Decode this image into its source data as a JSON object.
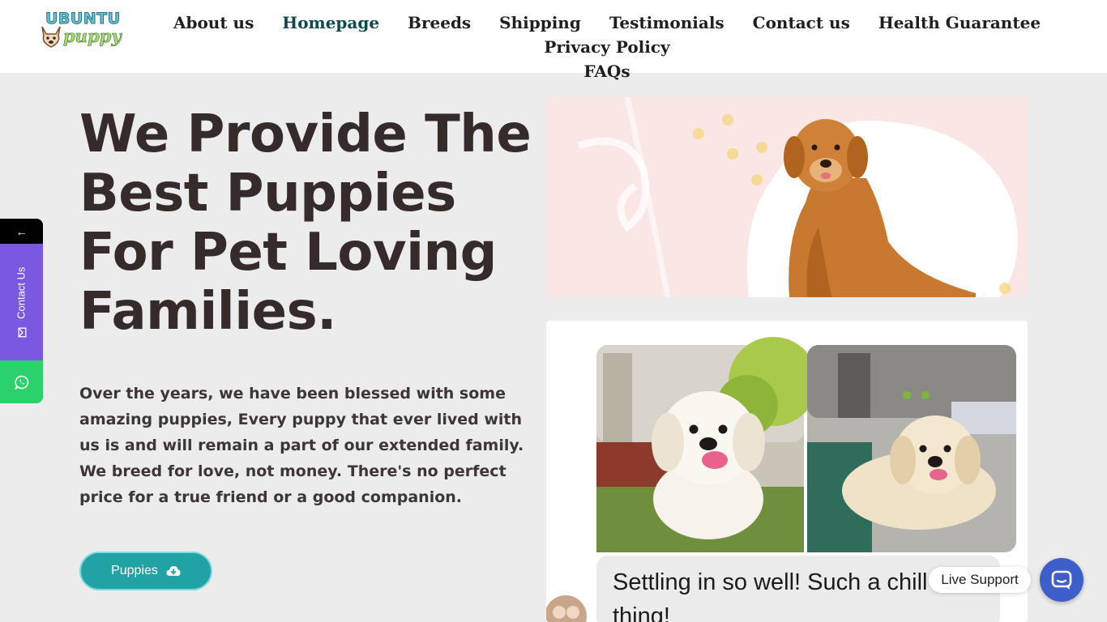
{
  "brand": {
    "logo_top": "UBUNTU",
    "logo_bottom": "puppy"
  },
  "nav": {
    "items": [
      "About us",
      "Homepage",
      "Breeds",
      "Shipping",
      "Testimonials",
      "Contact us",
      "Health Guarantee",
      "Privacy Policy",
      "FAQs"
    ],
    "active": "Homepage"
  },
  "hero": {
    "title": "We Provide The Best Puppies For Pet Loving Families.",
    "description": "Over the years, we have been blessed with some amazing puppies, Every puppy that ever lived with us is and will remain a part of our extended family. We breed for love, not money. There's no perfect price for a true friend or a good companion.",
    "button_label": "Puppies",
    "button_icon": "cloud-download-icon"
  },
  "review": {
    "text": "Settling in so well! Such a chill thing!"
  },
  "side_widget": {
    "arrow": "←",
    "contact_label": "Contact Us",
    "whatsapp_icon": "whatsapp-icon",
    "mail_icon": "envelope-icon"
  },
  "live_support": {
    "label": "Live Support",
    "icon": "chat-icon"
  },
  "colors": {
    "accent": "#21a3a6",
    "active_nav": "#0e4a4d",
    "heading": "#352b2b",
    "contact_purple": "#7b58e0",
    "whatsapp_green": "#2bd16b",
    "live_blue": "#3e5ec9"
  }
}
